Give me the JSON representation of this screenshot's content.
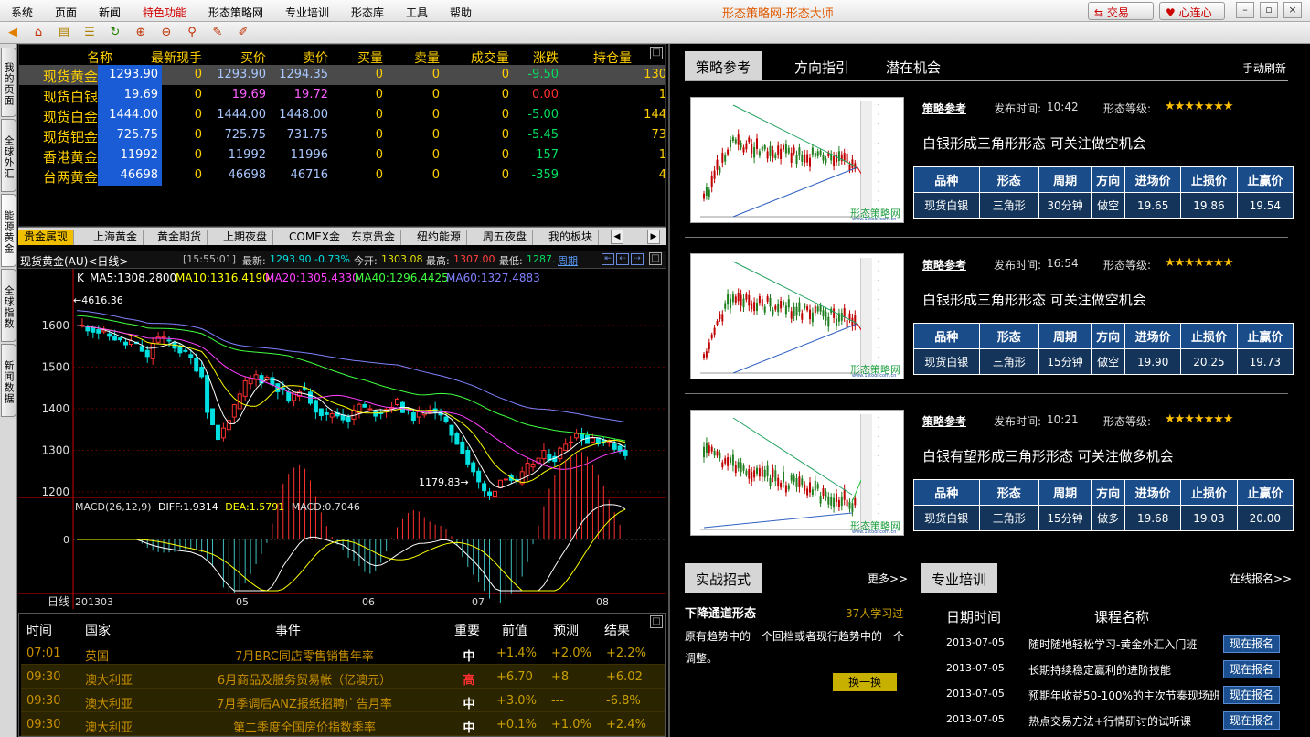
{
  "menu": {
    "items": [
      "系统",
      "页面",
      "新闻",
      "特色功能",
      "形态策略网",
      "专业培训",
      "形态库",
      "工具",
      "帮助"
    ],
    "title": "形态策略网-形态大师",
    "trade_button": "交易",
    "heart_button": "心连心"
  },
  "vtabs": [
    "我的页面",
    "全球外汇",
    "能源黄金",
    "全球指数",
    "新闻数据"
  ],
  "quotes": {
    "headers": [
      "名称",
      "最新",
      "现手",
      "买价",
      "卖价",
      "买量",
      "卖量",
      "成交量",
      "涨跌",
      "持仓量"
    ],
    "rows": [
      {
        "name": "现货黄金",
        "last": "1293.90",
        "hand": "0",
        "bid": "1293.90",
        "ask": "1294.35",
        "bidv": "0",
        "askv": "0",
        "vol": "0",
        "chg": "-9.50",
        "pos": "130"
      },
      {
        "name": "现货白银",
        "last": "19.69",
        "hand": "0",
        "bid": "19.69",
        "ask": "19.72",
        "bidv": "0",
        "askv": "0",
        "vol": "0",
        "chg": "0.00",
        "pos": "1"
      },
      {
        "name": "现货白金",
        "last": "1444.00",
        "hand": "0",
        "bid": "1444.00",
        "ask": "1448.00",
        "bidv": "0",
        "askv": "0",
        "vol": "0",
        "chg": "-5.00",
        "pos": "144"
      },
      {
        "name": "现货钯金",
        "last": "725.75",
        "hand": "0",
        "bid": "725.75",
        "ask": "731.75",
        "bidv": "0",
        "askv": "0",
        "vol": "0",
        "chg": "-5.45",
        "pos": "73"
      },
      {
        "name": "香港黄金",
        "last": "11992",
        "hand": "0",
        "bid": "11992",
        "ask": "11996",
        "bidv": "0",
        "askv": "0",
        "vol": "0",
        "chg": "-157",
        "pos": "1"
      },
      {
        "name": "台两黄金",
        "last": "46698",
        "hand": "0",
        "bid": "46698",
        "ask": "46716",
        "bidv": "0",
        "askv": "0",
        "vol": "0",
        "chg": "-359",
        "pos": "4"
      }
    ]
  },
  "qtabs": [
    "贵金属现",
    "上海黄金",
    "黄金期货",
    "上期夜盘",
    "COMEX金",
    "东京贵金",
    "纽约能源",
    "周五夜盘",
    "我的板块"
  ],
  "chart": {
    "title": "现货黄金(AU)<日线>",
    "time": "[15:55:01]",
    "latest_label": "最新:",
    "latest": "1293.90 -0.73%",
    "open_label": "今开:",
    "open": "1303.08",
    "high_label": "最高:",
    "high": "1307.00",
    "low_label": "最低:",
    "low": "1287.",
    "period": "周期",
    "ma": {
      "k": "K",
      "ma5": "MA5:1308.2800",
      "ma10": "MA10:1316.4190",
      "ma20": "MA20:1305.4330",
      "ma40": "MA40:1296.4425",
      "ma60": "MA60:1327.4883"
    },
    "y_ticks": [
      "1600",
      "1500",
      "1400",
      "1300",
      "1200"
    ],
    "hi_label": "4616.36",
    "lo_label": "1179.83",
    "macd": {
      "label": "MACD(26,12,9)",
      "diff": "DIFF:1.9314",
      "dea": "DEA:1.5791",
      "macd": "MACD:0.7046",
      "zero": "0"
    },
    "x_axis": {
      "period": "日线",
      "ticks": [
        "201303",
        "05",
        "06",
        "07",
        "08"
      ]
    }
  },
  "events": {
    "headers": [
      "时间",
      "国家",
      "事件",
      "重要",
      "前值",
      "预测",
      "结果"
    ],
    "rows": [
      {
        "time": "07:01",
        "country": "英国",
        "event": "7月BRC同店零售销售年率",
        "imp": "中",
        "prev": "+1.4%",
        "fc": "+2.0%",
        "res": "+2.2%"
      },
      {
        "time": "09:30",
        "country": "澳大利亚",
        "event": "6月商品及服务贸易帐（亿澳元）",
        "imp": "高",
        "prev": "+6.70",
        "fc": "+8",
        "res": "+6.02"
      },
      {
        "time": "09:30",
        "country": "澳大利亚",
        "event": "7月季调后ANZ报纸招聘广告月率",
        "imp": "中",
        "prev": "+3.0%",
        "fc": "---",
        "res": "-6.8%"
      },
      {
        "time": "09:30",
        "country": "澳大利亚",
        "event": "第二季度全国房价指数季率",
        "imp": "中",
        "prev": "+0.1%",
        "fc": "+1.0%",
        "res": "+2.4%"
      }
    ]
  },
  "right": {
    "tabs": [
      "策略参考",
      "方向指引",
      "潜在机会"
    ],
    "refresh": "手动刷新",
    "cards": [
      {
        "tag": "策略参考",
        "time_label": "发布时间:",
        "time": "10:42",
        "level_label": "形态等级:",
        "stars": "★★★★★★★",
        "title": "白银形成三角形形态  可关注做空机会",
        "headers": [
          "品种",
          "形态",
          "周期",
          "方向",
          "进场价",
          "止损价",
          "止赢价"
        ],
        "row": [
          "现货白银",
          "三角形",
          "30分钟",
          "做空",
          "19.65",
          "19.86",
          "19.54"
        ]
      },
      {
        "tag": "策略参考",
        "time_label": "发布时间:",
        "time": "16:54",
        "level_label": "形态等级:",
        "stars": "★★★★★★★",
        "title": "白银形成三角形形态  可关注做空机会",
        "headers": [
          "品种",
          "形态",
          "周期",
          "方向",
          "进场价",
          "止损价",
          "止赢价"
        ],
        "row": [
          "现货白银",
          "三角形",
          "15分钟",
          "做空",
          "19.90",
          "20.25",
          "19.73"
        ]
      },
      {
        "tag": "策略参考",
        "time_label": "发布时间:",
        "time": "10:21",
        "level_label": "形态等级:",
        "stars": "★★★★★★★",
        "title": "白银有望形成三角形形态  可关注做多机会",
        "headers": [
          "品种",
          "形态",
          "周期",
          "方向",
          "进场价",
          "止损价",
          "止赢价"
        ],
        "row": [
          "现货白银",
          "三角形",
          "15分钟",
          "做多",
          "19.68",
          "19.03",
          "20.00"
        ]
      }
    ],
    "thumb_watermark": "形态策略网",
    "thumb_url": "www.1stool.com.cn",
    "practice": {
      "tab": "实战招式",
      "more": "更多>>",
      "title": "下降通道形态",
      "count": "37人学习过",
      "desc": "原有趋势中的一个回档或者现行趋势中的一个调整。",
      "swap": "换一换"
    },
    "training": {
      "tab": "专业培训",
      "signup": "在线报名>>",
      "col_date": "日期时间",
      "col_name": "课程名称",
      "rows": [
        {
          "date": "2013-07-05",
          "name": "随时随地轻松学习-黄金外汇入门班",
          "btn": "现在报名"
        },
        {
          "date": "2013-07-05",
          "name": "长期持续稳定赢利的进阶技能",
          "btn": "现在报名"
        },
        {
          "date": "2013-07-05",
          "name": "预期年收益50-100%的主次节奏现场班",
          "btn": "现在报名"
        },
        {
          "date": "2013-07-05",
          "name": "热点交易方法+行情研讨的试听课",
          "btn": "现在报名"
        }
      ]
    }
  }
}
